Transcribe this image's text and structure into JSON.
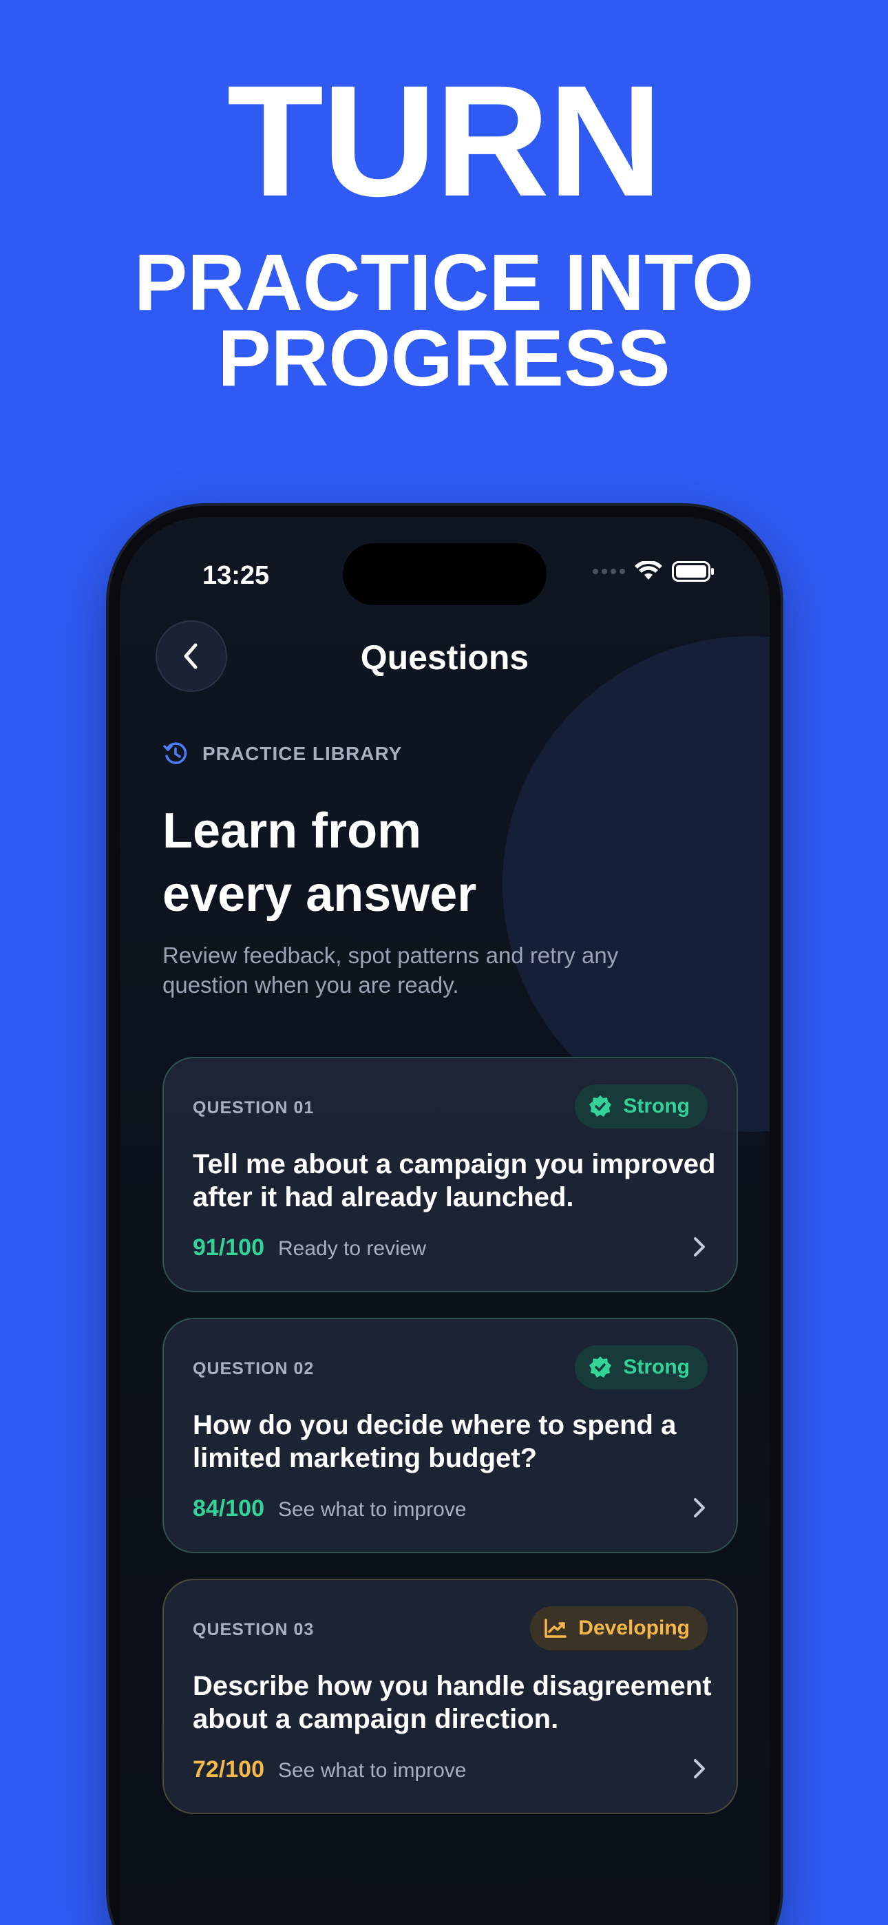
{
  "headline": {
    "big": "TURN",
    "line1": "PRACTICE INTO",
    "line2": "PROGRESS"
  },
  "status_bar": {
    "time": "13:25"
  },
  "nav": {
    "title": "Questions",
    "back_icon": "chevron-left-icon"
  },
  "hero": {
    "eyebrow": "PRACTICE LIBRARY",
    "eyebrow_icon": "history-icon",
    "title_line1": "Learn from",
    "title_line2": "every answer",
    "subtitle_line1": "Review feedback, spot patterns and retry any",
    "subtitle_line2": "question when you are ready."
  },
  "questions": [
    {
      "label": "QUESTION 01",
      "badge": "Strong",
      "badge_icon": "verified-check-icon",
      "line1": "Tell me about a campaign you improved",
      "line2": "after it had already launched.",
      "score": "91/100",
      "hint": "Ready to review"
    },
    {
      "label": "QUESTION 02",
      "badge": "Strong",
      "badge_icon": "verified-check-icon",
      "line1": "How do you decide where to spend a",
      "line2": "limited marketing budget?",
      "score": "84/100",
      "hint": "See what to improve"
    },
    {
      "label": "QUESTION 03",
      "badge": "Developing",
      "badge_icon": "trending-up-icon",
      "line1": "Describe how you handle disagreement",
      "line2": "about a campaign direction.",
      "score": "72/100",
      "hint": "See what to improve"
    }
  ],
  "colors": {
    "background": "#2f5bf4",
    "strong": "#34d399",
    "developing": "#f5b84a"
  }
}
